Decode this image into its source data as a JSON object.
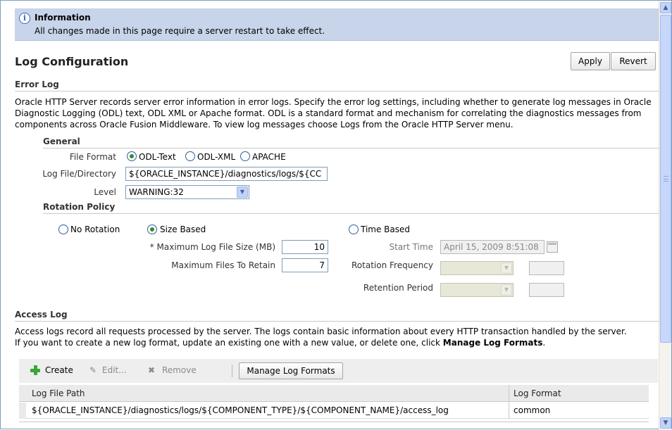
{
  "info": {
    "title": "Information",
    "message": "All changes made in this page require a server restart to take effect."
  },
  "page": {
    "title": "Log Configuration",
    "apply_label": "Apply",
    "revert_label": "Revert"
  },
  "error_log": {
    "heading": "Error Log",
    "description": "Oracle HTTP Server records server error information in error logs. Specify the error log settings, including whether to generate log messages in Oracle Diagnostic Logging (ODL) text, ODL XML or Apache format. ODL is a standard format and mechanism for correlating the diagnostics messages from components across Oracle Fusion Middleware. To view log messages choose Logs from the Oracle HTTP Server menu.",
    "general": {
      "heading": "General",
      "file_format_label": "File Format",
      "file_format_options": [
        "ODL-Text",
        "ODL-XML",
        "APACHE"
      ],
      "file_format_selected": "ODL-Text",
      "log_dir_label": "Log File/Directory",
      "log_dir_value": "${ORACLE_INSTANCE}/diagnostics/logs/${CC",
      "level_label": "Level",
      "level_value": "WARNING:32"
    },
    "rotation": {
      "heading": "Rotation Policy",
      "no_rotation_label": "No Rotation",
      "size_based_label": "Size Based",
      "time_based_label": "Time Based",
      "selected": "Size Based",
      "max_size_label": "* Maximum Log File Size (MB)",
      "max_size_value": "10",
      "max_files_label": "Maximum Files To Retain",
      "max_files_value": "7",
      "start_time_label": "Start Time",
      "start_time_value": "April 15, 2009 8:51:08",
      "rotation_freq_label": "Rotation Frequency",
      "retention_label": "Retention Period"
    }
  },
  "access_log": {
    "heading": "Access Log",
    "description_1": "Access logs record all requests processed by the server. The logs contain basic information about every HTTP transaction handled by the server.",
    "description_2": "If you want to create a new log format, update an existing one with a new value, or delete one, click",
    "description_link": "Manage Log Formats",
    "description_end": ".",
    "toolbar": {
      "create_label": "Create",
      "edit_label": "Edit...",
      "remove_label": "Remove",
      "manage_label": "Manage Log Formats"
    },
    "columns": [
      "Log File Path",
      "Log Format"
    ],
    "rows": [
      {
        "path": "${ORACLE_INSTANCE}/diagnostics/logs/${COMPONENT_TYPE}/${COMPONENT_NAME}/access_log",
        "format": "common"
      }
    ]
  }
}
